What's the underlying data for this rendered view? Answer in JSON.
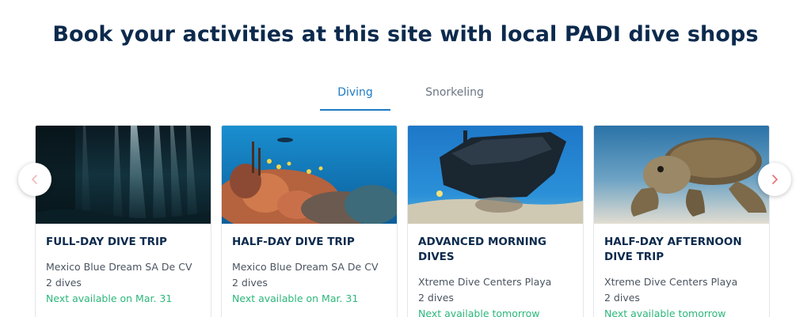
{
  "heading": "Book your activities at this site with local PADI dive shops",
  "tabs": [
    {
      "label": "Diving",
      "active": true
    },
    {
      "label": "Snorkeling",
      "active": false
    }
  ],
  "nav": {
    "prev_icon": "chevron-left-icon",
    "next_icon": "chevron-right-icon"
  },
  "cards": [
    {
      "title": "FULL-DAY DIVE TRIP",
      "shop": "Mexico Blue Dream SA De CV",
      "dives": "2 dives",
      "availability": "Next available on Mar. 31",
      "image": "cenote-light-rays-photo"
    },
    {
      "title": "HALF-DAY DIVE TRIP",
      "shop": "Mexico Blue Dream SA De CV",
      "dives": "2 dives",
      "availability": "Next available on Mar. 31",
      "image": "coral-reef-diver-photo"
    },
    {
      "title": "ADVANCED MORNING DIVES",
      "shop": "Xtreme Dive Centers Playa",
      "dives": "2 dives",
      "availability": "Next available tomorrow",
      "image": "shipwreck-photo"
    },
    {
      "title": "HALF-DAY AFTERNOON DIVE TRIP",
      "shop": "Xtreme Dive Centers Playa",
      "dives": "2 dives",
      "availability": "Next available tomorrow",
      "image": "sea-turtle-photo"
    }
  ],
  "colors": {
    "heading": "#0c2a4d",
    "tab_active": "#1e7bc4",
    "tab_inactive": "#6b7684",
    "availability": "#2cb77a",
    "chevron": "#e8757a"
  }
}
